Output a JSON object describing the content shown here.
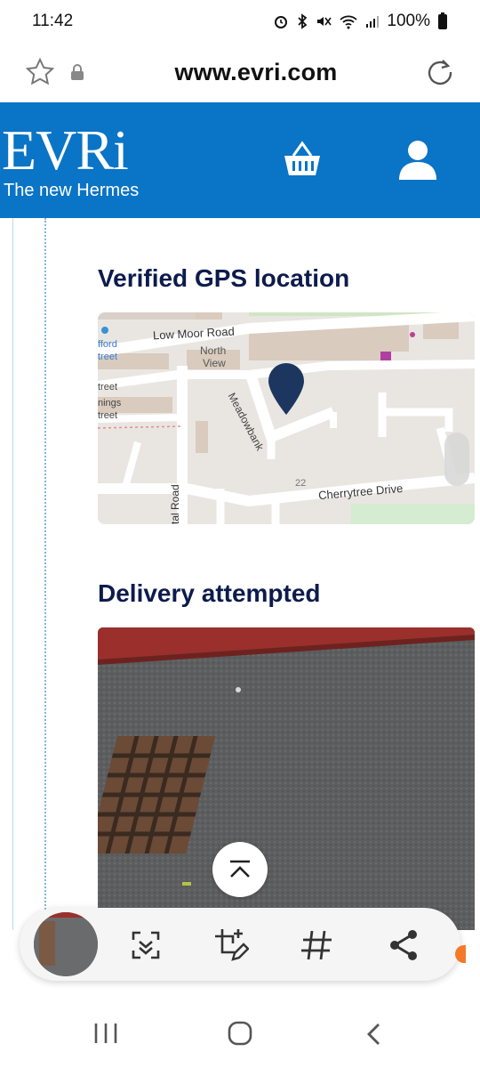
{
  "status": {
    "time": "11:42",
    "battery": "100%"
  },
  "browser": {
    "url": "www.evri.com"
  },
  "header": {
    "brand": "EVRi",
    "tagline": "The new Hermes",
    "basket_icon": "basket-icon",
    "account_icon": "user-icon"
  },
  "sections": {
    "gps_title": "Verified GPS location",
    "attempt_title": "Delivery attempted"
  },
  "map": {
    "labels": {
      "low_moor": "Low Moor Road",
      "north_view_1": "North",
      "north_view_2": "View",
      "meadowbank": "Meadowbank",
      "cherrytree": "Cherrytree Drive",
      "house_number": "22",
      "street1": "treet",
      "street2": "nings",
      "street3": "treet",
      "afford": "fford",
      "afford2": "treet",
      "tal_road": "tal Road"
    },
    "pin_color": "#1c3660"
  },
  "toolbar": {
    "items": [
      "scan-icon",
      "crop-edit-icon",
      "hashtag-icon",
      "share-icon"
    ]
  },
  "colors": {
    "brand_blue": "#0a74c6",
    "heading_navy": "#0d1b4c"
  }
}
